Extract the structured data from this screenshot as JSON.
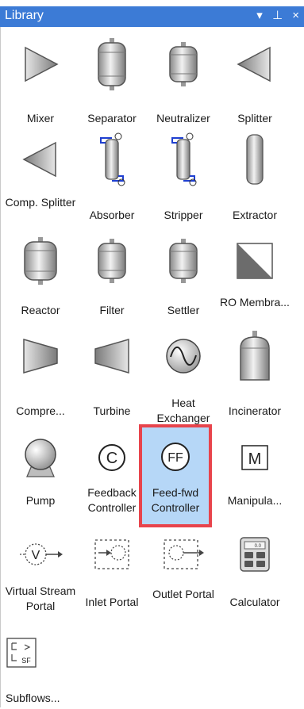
{
  "panel": {
    "title": "Library",
    "controls": {
      "dropdown": "▾",
      "pin": "⊥",
      "close": "×"
    }
  },
  "items": [
    {
      "label": "Mixer",
      "icon": "mixer-icon"
    },
    {
      "label": "Separator",
      "icon": "separator-icon"
    },
    {
      "label": "Neutralizer",
      "icon": "neutralizer-icon"
    },
    {
      "label": "Splitter",
      "icon": "splitter-icon"
    },
    {
      "label": "Comp. Splitter",
      "icon": "comp-splitter-icon"
    },
    {
      "label": "Absorber",
      "icon": "absorber-icon"
    },
    {
      "label": "Stripper",
      "icon": "stripper-icon"
    },
    {
      "label": "Extractor",
      "icon": "extractor-icon"
    },
    {
      "label": "Reactor",
      "icon": "reactor-icon"
    },
    {
      "label": "Filter",
      "icon": "filter-icon"
    },
    {
      "label": "Settler",
      "icon": "settler-icon"
    },
    {
      "label": "RO Membra...",
      "icon": "ro-membrane-icon"
    },
    {
      "label": "Compre...",
      "icon": "compressor-icon"
    },
    {
      "label": "Turbine",
      "icon": "turbine-icon"
    },
    {
      "label": "Heat Exchanger",
      "icon": "heat-exchanger-icon"
    },
    {
      "label": "Incinerator",
      "icon": "incinerator-icon"
    },
    {
      "label": "Pump",
      "icon": "pump-icon"
    },
    {
      "label": "Feedback Controller",
      "icon": "feedback-controller-icon",
      "glyph": "C"
    },
    {
      "label": "Feed-fwd Controller",
      "icon": "feedfwd-controller-icon",
      "glyph": "FF",
      "selected": true
    },
    {
      "label": "Manipula...",
      "icon": "manipulator-icon",
      "glyph": "M"
    },
    {
      "label": "Virtual Stream Portal",
      "icon": "virtual-stream-portal-icon",
      "glyph": "V"
    },
    {
      "label": "Inlet Portal",
      "icon": "inlet-portal-icon"
    },
    {
      "label": "Outlet Portal",
      "icon": "outlet-portal-icon"
    },
    {
      "label": "Calculator",
      "icon": "calculator-icon",
      "glyph": "0.0"
    },
    {
      "label": "Subflows...",
      "icon": "subflows-icon",
      "glyph": "SF"
    }
  ],
  "colors": {
    "titlebar": "#3c7bd6",
    "selection": "#b6d7f7",
    "selection_border": "#e8444c"
  }
}
